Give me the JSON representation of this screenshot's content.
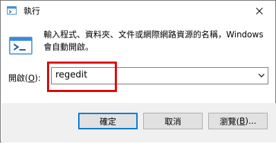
{
  "window": {
    "title": "執行"
  },
  "dialog": {
    "description": "輸入程式、資料夾、文件或網際網路資源的名稱，Windows 會自動開啟。",
    "open_label_prefix": "開啟(",
    "open_label_hotkey": "O",
    "open_label_suffix": "):",
    "open_value": "regedit"
  },
  "buttons": {
    "ok": "確定",
    "cancel": "取消",
    "browse_prefix": "瀏覽(",
    "browse_hotkey": "B",
    "browse_suffix": ")..."
  },
  "colors": {
    "highlight": "#e00000",
    "accent": "#0078d7",
    "footer": "#f0f0f0"
  },
  "icons": [
    "run-title-icon",
    "close-icon",
    "run-app-icon",
    "chevron-down-icon"
  ]
}
